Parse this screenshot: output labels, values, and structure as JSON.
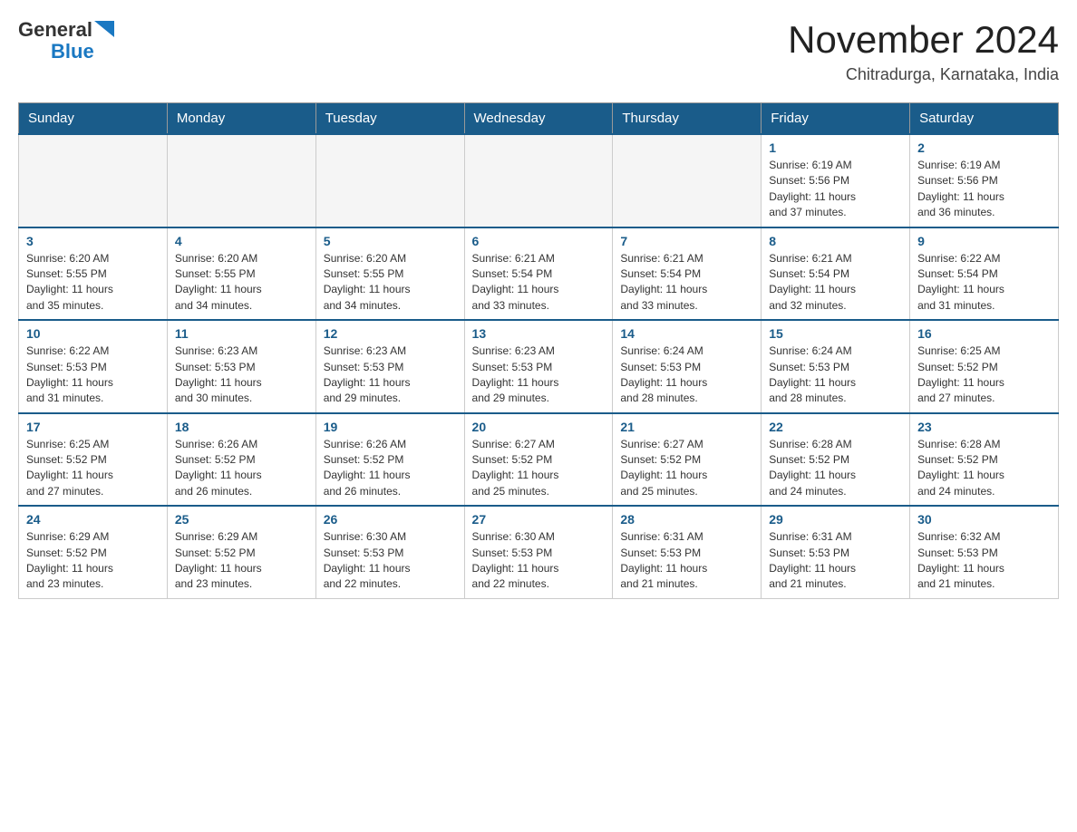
{
  "header": {
    "logo_general": "General",
    "logo_blue": "Blue",
    "title": "November 2024",
    "subtitle": "Chitradurga, Karnataka, India"
  },
  "days_of_week": [
    "Sunday",
    "Monday",
    "Tuesday",
    "Wednesday",
    "Thursday",
    "Friday",
    "Saturday"
  ],
  "weeks": [
    [
      {
        "day": "",
        "info": ""
      },
      {
        "day": "",
        "info": ""
      },
      {
        "day": "",
        "info": ""
      },
      {
        "day": "",
        "info": ""
      },
      {
        "day": "",
        "info": ""
      },
      {
        "day": "1",
        "info": "Sunrise: 6:19 AM\nSunset: 5:56 PM\nDaylight: 11 hours\nand 37 minutes."
      },
      {
        "day": "2",
        "info": "Sunrise: 6:19 AM\nSunset: 5:56 PM\nDaylight: 11 hours\nand 36 minutes."
      }
    ],
    [
      {
        "day": "3",
        "info": "Sunrise: 6:20 AM\nSunset: 5:55 PM\nDaylight: 11 hours\nand 35 minutes."
      },
      {
        "day": "4",
        "info": "Sunrise: 6:20 AM\nSunset: 5:55 PM\nDaylight: 11 hours\nand 34 minutes."
      },
      {
        "day": "5",
        "info": "Sunrise: 6:20 AM\nSunset: 5:55 PM\nDaylight: 11 hours\nand 34 minutes."
      },
      {
        "day": "6",
        "info": "Sunrise: 6:21 AM\nSunset: 5:54 PM\nDaylight: 11 hours\nand 33 minutes."
      },
      {
        "day": "7",
        "info": "Sunrise: 6:21 AM\nSunset: 5:54 PM\nDaylight: 11 hours\nand 33 minutes."
      },
      {
        "day": "8",
        "info": "Sunrise: 6:21 AM\nSunset: 5:54 PM\nDaylight: 11 hours\nand 32 minutes."
      },
      {
        "day": "9",
        "info": "Sunrise: 6:22 AM\nSunset: 5:54 PM\nDaylight: 11 hours\nand 31 minutes."
      }
    ],
    [
      {
        "day": "10",
        "info": "Sunrise: 6:22 AM\nSunset: 5:53 PM\nDaylight: 11 hours\nand 31 minutes."
      },
      {
        "day": "11",
        "info": "Sunrise: 6:23 AM\nSunset: 5:53 PM\nDaylight: 11 hours\nand 30 minutes."
      },
      {
        "day": "12",
        "info": "Sunrise: 6:23 AM\nSunset: 5:53 PM\nDaylight: 11 hours\nand 29 minutes."
      },
      {
        "day": "13",
        "info": "Sunrise: 6:23 AM\nSunset: 5:53 PM\nDaylight: 11 hours\nand 29 minutes."
      },
      {
        "day": "14",
        "info": "Sunrise: 6:24 AM\nSunset: 5:53 PM\nDaylight: 11 hours\nand 28 minutes."
      },
      {
        "day": "15",
        "info": "Sunrise: 6:24 AM\nSunset: 5:53 PM\nDaylight: 11 hours\nand 28 minutes."
      },
      {
        "day": "16",
        "info": "Sunrise: 6:25 AM\nSunset: 5:52 PM\nDaylight: 11 hours\nand 27 minutes."
      }
    ],
    [
      {
        "day": "17",
        "info": "Sunrise: 6:25 AM\nSunset: 5:52 PM\nDaylight: 11 hours\nand 27 minutes."
      },
      {
        "day": "18",
        "info": "Sunrise: 6:26 AM\nSunset: 5:52 PM\nDaylight: 11 hours\nand 26 minutes."
      },
      {
        "day": "19",
        "info": "Sunrise: 6:26 AM\nSunset: 5:52 PM\nDaylight: 11 hours\nand 26 minutes."
      },
      {
        "day": "20",
        "info": "Sunrise: 6:27 AM\nSunset: 5:52 PM\nDaylight: 11 hours\nand 25 minutes."
      },
      {
        "day": "21",
        "info": "Sunrise: 6:27 AM\nSunset: 5:52 PM\nDaylight: 11 hours\nand 25 minutes."
      },
      {
        "day": "22",
        "info": "Sunrise: 6:28 AM\nSunset: 5:52 PM\nDaylight: 11 hours\nand 24 minutes."
      },
      {
        "day": "23",
        "info": "Sunrise: 6:28 AM\nSunset: 5:52 PM\nDaylight: 11 hours\nand 24 minutes."
      }
    ],
    [
      {
        "day": "24",
        "info": "Sunrise: 6:29 AM\nSunset: 5:52 PM\nDaylight: 11 hours\nand 23 minutes."
      },
      {
        "day": "25",
        "info": "Sunrise: 6:29 AM\nSunset: 5:52 PM\nDaylight: 11 hours\nand 23 minutes."
      },
      {
        "day": "26",
        "info": "Sunrise: 6:30 AM\nSunset: 5:53 PM\nDaylight: 11 hours\nand 22 minutes."
      },
      {
        "day": "27",
        "info": "Sunrise: 6:30 AM\nSunset: 5:53 PM\nDaylight: 11 hours\nand 22 minutes."
      },
      {
        "day": "28",
        "info": "Sunrise: 6:31 AM\nSunset: 5:53 PM\nDaylight: 11 hours\nand 21 minutes."
      },
      {
        "day": "29",
        "info": "Sunrise: 6:31 AM\nSunset: 5:53 PM\nDaylight: 11 hours\nand 21 minutes."
      },
      {
        "day": "30",
        "info": "Sunrise: 6:32 AM\nSunset: 5:53 PM\nDaylight: 11 hours\nand 21 minutes."
      }
    ]
  ]
}
